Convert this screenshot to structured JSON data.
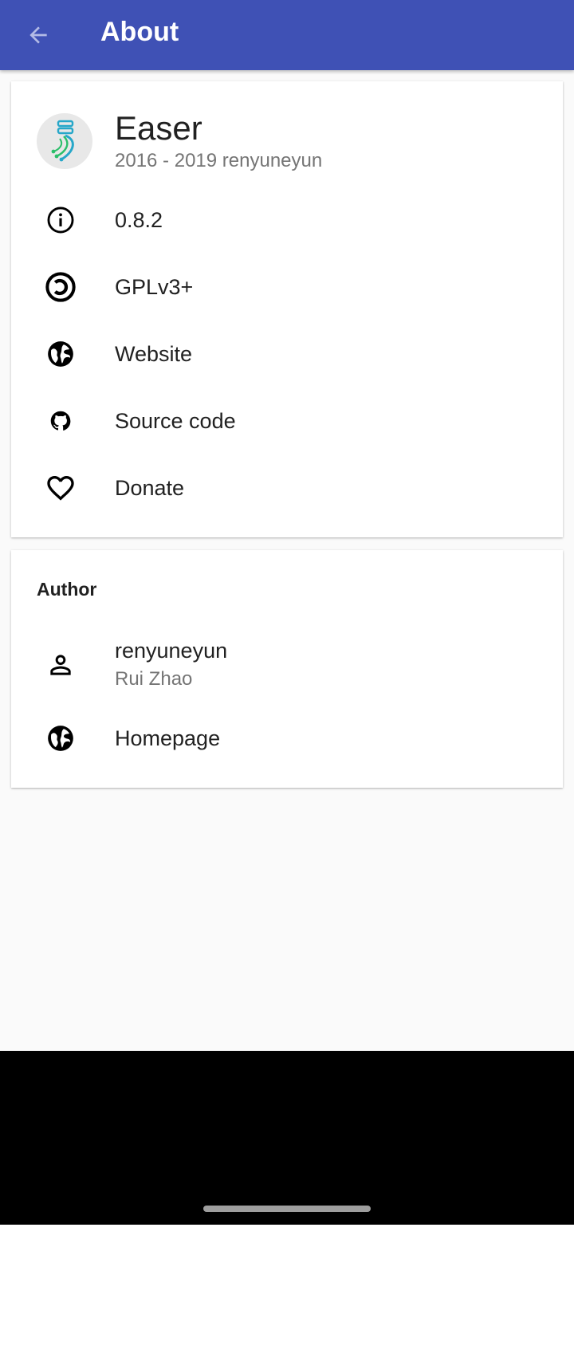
{
  "toolbar": {
    "title": "About",
    "back_icon": "arrow-left-icon"
  },
  "app_info": {
    "name": "Easer",
    "copyright": "2016 - 2019 renyuneyun",
    "logo_icon": "easer-logo-icon"
  },
  "info_items": [
    {
      "label": "0.8.2",
      "icon": "info-icon"
    },
    {
      "label": "GPLv3+",
      "icon": "copyleft-icon"
    },
    {
      "label": "Website",
      "icon": "globe-icon"
    },
    {
      "label": "Source code",
      "icon": "github-icon"
    },
    {
      "label": "Donate",
      "icon": "heart-icon"
    }
  ],
  "author_section": {
    "header": "Author",
    "author": {
      "name": "renyuneyun",
      "real_name": "Rui Zhao",
      "icon": "person-icon"
    },
    "homepage": {
      "label": "Homepage",
      "icon": "globe-icon"
    }
  },
  "colors": {
    "primary": "#3f51b5",
    "background": "#fafafa",
    "text_primary": "#212121",
    "text_secondary": "#757575"
  }
}
